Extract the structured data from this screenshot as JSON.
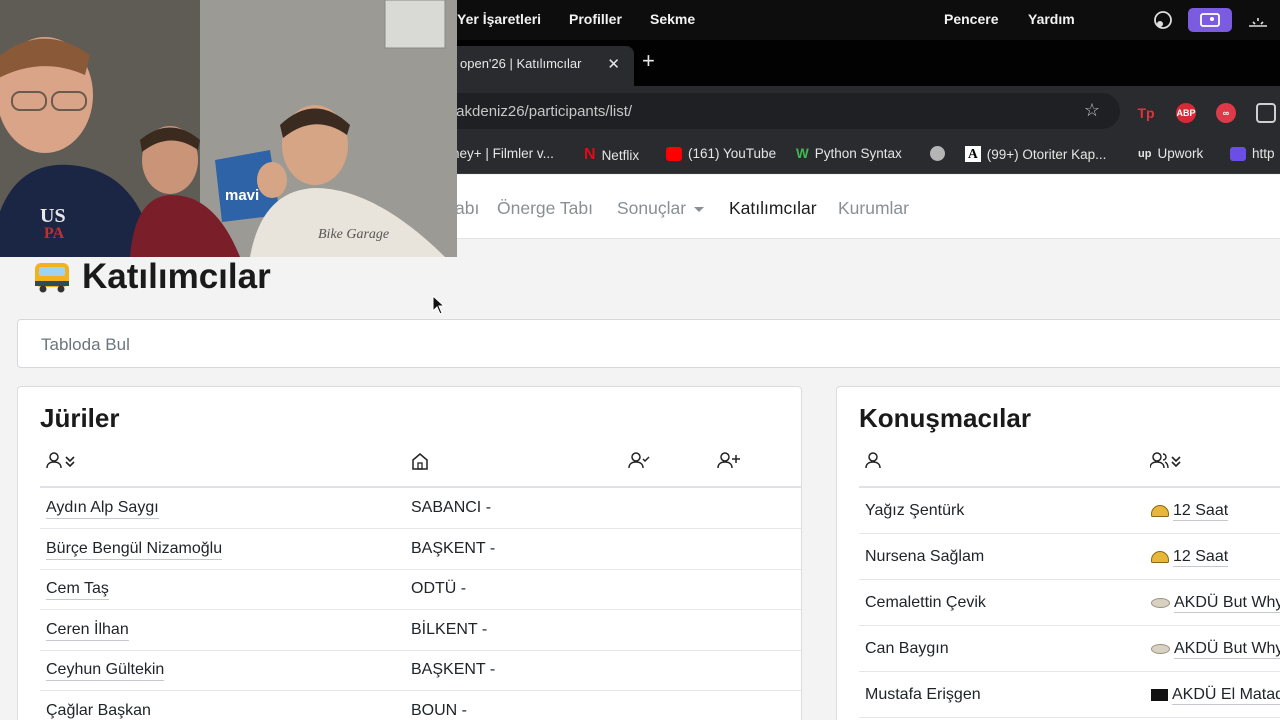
{
  "menubar": {
    "items": [
      "Yer İşaretleri",
      "Profiller",
      "Sekme",
      "Pencere",
      "Yardım"
    ]
  },
  "browser": {
    "tab_title": "open'26 | Katılımcılar",
    "url": "/akdeniz26/participants/list/",
    "bookmarks": [
      "ney+ | Filmler v...",
      "Netflix",
      "(161) YouTube",
      "Python Syntax",
      "(99+) Otoriter Kap...",
      "Upwork",
      "http"
    ],
    "extensions": [
      "Tp",
      "ABP"
    ]
  },
  "nav": {
    "items": [
      "abı",
      "Önerge Tabı",
      "Sonuçlar",
      "Katılımcılar",
      "Kurumlar"
    ],
    "active": "Katılımcılar"
  },
  "page": {
    "title": "Katılımcılar",
    "search_placeholder": "Tabloda Bul"
  },
  "judges": {
    "title": "Jüriler",
    "rows": [
      {
        "name": "Aydın Alp Saygı",
        "institution": "SABANCI -"
      },
      {
        "name": "Bürçe Bengül Nizamoğlu",
        "institution": "BAŞKENT -"
      },
      {
        "name": "Cem Taş",
        "institution": "ODTÜ -"
      },
      {
        "name": "Ceren İlhan",
        "institution": "BİLKENT -"
      },
      {
        "name": "Ceyhun Gültekin",
        "institution": "BAŞKENT -"
      },
      {
        "name": "Çağlar Başkan",
        "institution": "BOUN -"
      }
    ]
  },
  "speakers": {
    "title": "Konuşmacılar",
    "rows": [
      {
        "name": "Yağız Şentürk",
        "team": "12 Saat",
        "team_icon": "taco-icon"
      },
      {
        "name": "Nursena Sağlam",
        "team": "12 Saat",
        "team_icon": "taco-icon"
      },
      {
        "name": "Cemalettin Çevik",
        "team": "AKDÜ But Why",
        "team_icon": "flatbread-icon"
      },
      {
        "name": "Can Baygın",
        "team": "AKDÜ But Why",
        "team_icon": "flatbread-icon"
      },
      {
        "name": "Mustafa Erişgen",
        "team": "AKDÜ El Matad",
        "team_icon": "black-flag-icon"
      }
    ]
  },
  "webcam": {
    "shirt_text": "USPA",
    "bag_text": "mavi",
    "tshirt_text": "Bike Garage"
  },
  "colors": {
    "active_nav": "#1d1d1f",
    "inactive_nav": "#8a8f94",
    "menubar": "#0d0d0e",
    "chrome_toolbar": "#2a2b2e"
  }
}
